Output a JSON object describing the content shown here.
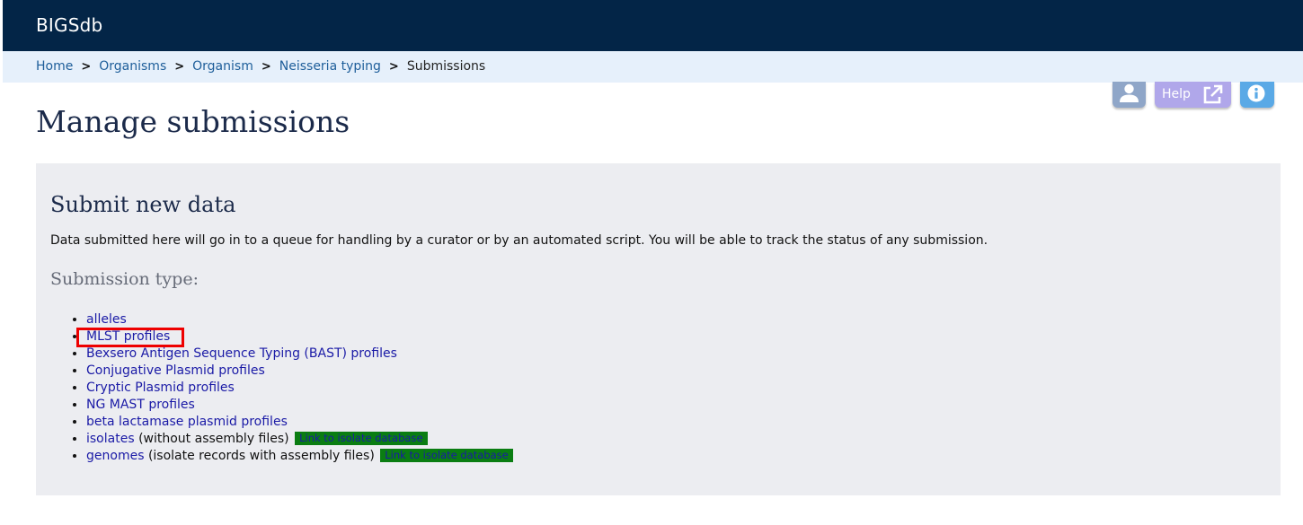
{
  "app": {
    "brand": "BIGSdb"
  },
  "breadcrumb": {
    "items": [
      "Home",
      "Organisms",
      "Organism",
      "Neisseria typing"
    ],
    "current": "Submissions",
    "separator": ">"
  },
  "toolbar": {
    "user_icon": "user-icon",
    "help_label": "Help",
    "help_icon": "external-link-icon",
    "info_icon": "info-icon"
  },
  "page": {
    "title": "Manage submissions"
  },
  "panel": {
    "heading": "Submit new data",
    "description": "Data submitted here will go in to a queue for handling by a curator or by an automated script. You will be able to track the status of any submission.",
    "subheading": "Submission type:",
    "types": [
      {
        "label": "alleles"
      },
      {
        "label": "MLST profiles",
        "highlighted": true
      },
      {
        "label": "Bexsero Antigen Sequence Typing (BAST) profiles"
      },
      {
        "label": "Conjugative Plasmid profiles"
      },
      {
        "label": "Cryptic Plasmid profiles"
      },
      {
        "label": "NG MAST profiles"
      },
      {
        "label": "beta lactamase plasmid profiles"
      },
      {
        "label": "isolates",
        "note": "(without assembly files)",
        "badge": "Link to isolate database"
      },
      {
        "label": "genomes",
        "note": "(isolate records with assembly files)",
        "badge": "Link to isolate database"
      }
    ]
  },
  "colors": {
    "header_bg": "#032547",
    "breadcrumb_bg": "#e6f0fb",
    "panel_bg": "#ecedf1",
    "link": "#1a1aa6",
    "badge_bg": "#0a7d12",
    "highlight": "#ee0000"
  }
}
